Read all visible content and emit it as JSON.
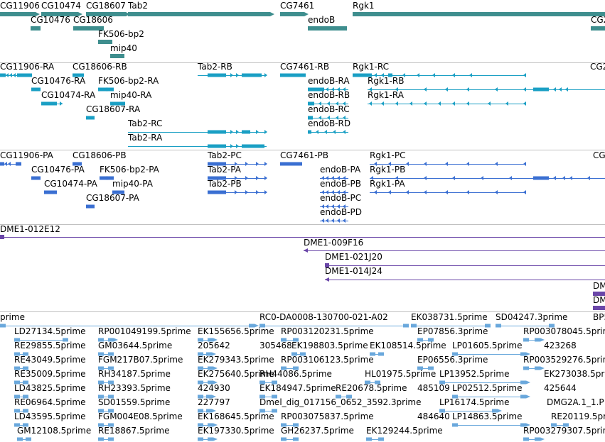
{
  "colors": {
    "gene": "#3e8e8e",
    "transcript": "#1a9fc4",
    "translation": "#3a6fd2",
    "clone": "#6a46a8",
    "est": "#6aa8dc",
    "separator": "#c0c0c0"
  },
  "tracks": [
    {
      "name": "gene",
      "icon": "gene-glyph"
    },
    {
      "name": "transcript",
      "icon": "transcript-glyph"
    },
    {
      "name": "translation",
      "icon": "translation-glyph"
    },
    {
      "name": "clone",
      "icon": "clone-glyph"
    },
    {
      "name": "est",
      "icon": "est-glyph"
    }
  ],
  "labels": {
    "gene": [
      "CG11906",
      "CG10474",
      "CG18607",
      "Tab2",
      "CG7461",
      "Rgk1",
      "CG10476",
      "CG18606",
      "endoB",
      "CG2",
      "FK506-bp2",
      "mip40"
    ],
    "transcript": [
      "CG11906-RA",
      "CG18606-RB",
      "Tab2-RB",
      "CG7461-RB",
      "Rgk1-RC",
      "CG2",
      "CG10476-RA",
      "FK506-bp2-RA",
      "endoB-RA",
      "Rgk1-RB",
      "CG10474-RA",
      "mip40-RA",
      "endoB-RB",
      "Rgk1-RA",
      "CG18607-RA",
      "endoB-RC",
      "Tab2-RC",
      "endoB-RD",
      "Tab2-RA"
    ],
    "translation": [
      "CG11906-PA",
      "CG18606-PB",
      "Tab2-PC",
      "CG7461-PB",
      "Rgk1-PC",
      "CG",
      "CG10476-PA",
      "FK506-bp2-PA",
      "Tab2-PA",
      "endoB-PA",
      "Rgk1-PB",
      "CG10474-PA",
      "mip40-PA",
      "Tab2-PB",
      "endoB-PB",
      "Rgk1-PA",
      "CG18607-PA",
      "endoB-PC",
      "endoB-PD"
    ],
    "clone": [
      "DME1-012E12",
      "DME1-009F16",
      "DME1-021J20",
      "DME1-014J24",
      "DM",
      "DM"
    ],
    "est": [
      "prime",
      "RC0-DA0008-130700-021-A02",
      "EK038731.5prime",
      "SD04247.3prime",
      "BP5",
      "LD27134.5prime",
      "RP001049199.5prime",
      "EK155656.5prime",
      "RP003120231.5prime",
      "EP07856.3prime",
      "RP003078045.5prime",
      "RE29855.5prime",
      "GM03644.5prime",
      "205642",
      "305468",
      "EK198803.5prime",
      "EK108514.5prime",
      "LP01605.5prime",
      "423268",
      "RE43049.5prime",
      "FGM217B07.5prime",
      "EK279343.5prime",
      "RP003106123.5prime",
      "EP06556.3prime",
      "RP003529276.5prime",
      "RE35009.5prime",
      "RH34187.5prime",
      "EK275640.5prime",
      "RH44086.5prime",
      "HL01975.5prime",
      "LP13952.5prime",
      "EK273038.5prime",
      "LD43825.5prime",
      "RH23393.5prime",
      "424930",
      "EK184947.5prime",
      "RE20678.5prime",
      "485109",
      "LP02512.5prime",
      "425644",
      "RE06964.5prime",
      "SD01559.5prime",
      "227797",
      "Dmel_dig_017156_0652_3592.3prime",
      "LP16174.5prime",
      "DMG2A.1_1.P",
      "LD43595.5prime",
      "FGM004E08.5prime",
      "EK168645.5prime",
      "RP003075837.5prime",
      "484640",
      "LP14863.5prime",
      "RE20119.5prime",
      "GM12108.5prime",
      "RE18867.5prime",
      "EK197330.5prime",
      "GH26237.5prime",
      "EK129244.5prime",
      "RP003279307.5prime"
    ]
  }
}
